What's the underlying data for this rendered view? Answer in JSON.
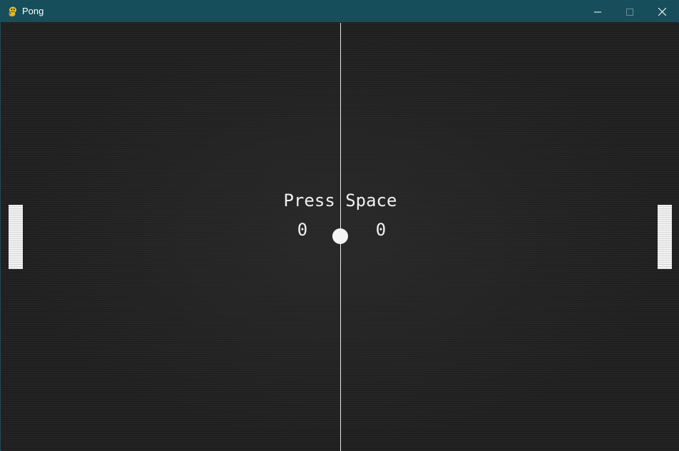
{
  "window": {
    "title": "Pong",
    "app_icon": "pygame-snake-icon",
    "controls": [
      "minimize-icon",
      "maximize-icon",
      "close-icon"
    ]
  },
  "game": {
    "prompt": "Press Space",
    "score_left": "0",
    "score_right": "0"
  },
  "colors": {
    "titlebar": "#174e5b",
    "background": "#1f1f1f",
    "foreground": "#f0f0f0"
  }
}
